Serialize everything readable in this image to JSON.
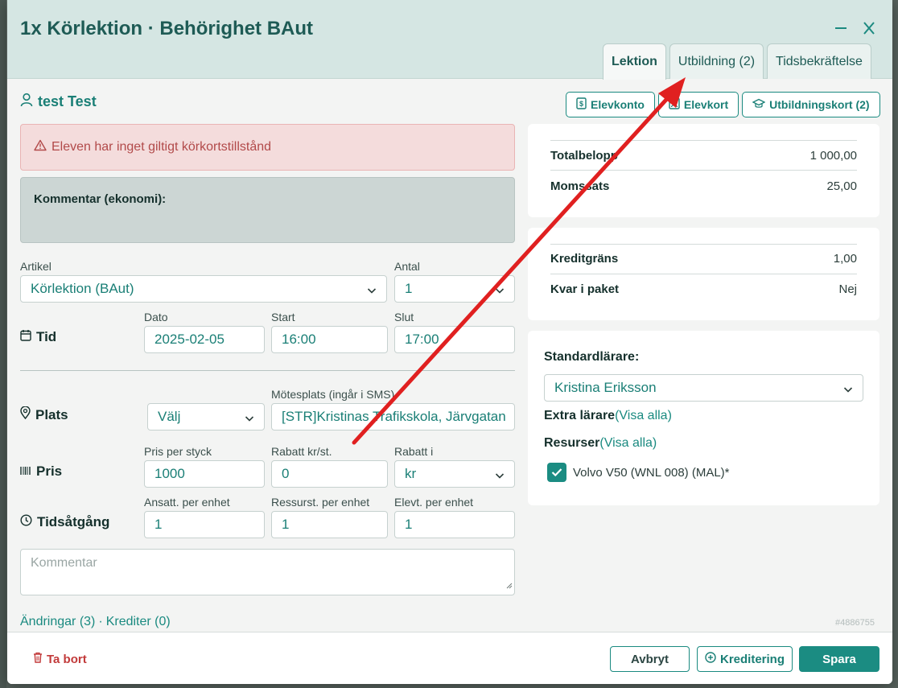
{
  "modal": {
    "title": "1x Körlektion · Behörighet BAut"
  },
  "tabs": [
    {
      "label": "Lektion"
    },
    {
      "label": "Utbildning (2)"
    },
    {
      "label": "Tidsbekräftelse"
    }
  ],
  "student": {
    "name": "test Test"
  },
  "head_buttons": {
    "account": "Elevkonto",
    "card": "Elevkort",
    "education_card": "Utbildningskort (2)"
  },
  "alert": {
    "text": "Eleven har inget giltigt körkortstillstånd"
  },
  "comment_economy": {
    "label": "Kommentar (ekonomi):"
  },
  "form": {
    "article": {
      "label": "Artikel",
      "value": "Körlektion (BAut)"
    },
    "quantity": {
      "label": "Antal",
      "value": "1"
    },
    "time": {
      "heading": "Tid",
      "date_label": "Dato",
      "date_value": "2025-02-05",
      "start_label": "Start",
      "start_value": "16:00",
      "end_label": "Slut",
      "end_value": "17:00"
    },
    "place": {
      "heading": "Plats",
      "select_value": "Välj",
      "meeting_label": "Mötesplats (ingår i SMS)",
      "meeting_value": "[STR]Kristinas Trafikskola, Järvgatan"
    },
    "price": {
      "heading": "Pris",
      "unit_label": "Pris per styck",
      "unit_value": "1000",
      "discount_label": "Rabatt kr/st.",
      "discount_value": "0",
      "discount_in_label": "Rabatt i",
      "discount_in_value": "kr"
    },
    "time_usage": {
      "heading": "Tidsåtgång",
      "employee_label": "Ansatt. per enhet",
      "employee_value": "1",
      "resource_label": "Ressurst. per enhet",
      "resource_value": "1",
      "student_label": "Elevt. per enhet",
      "student_value": "1"
    },
    "comment": {
      "placeholder": "Kommentar"
    },
    "changes": {
      "changes_link": "Ändringar (3)",
      "separator": "·",
      "credits_link": "Krediter (0)"
    },
    "record_id": "#4886755"
  },
  "summary": {
    "total_label": "Totalbelopp",
    "total_value": "1 000,00",
    "vat_label": "Momssats",
    "vat_value": "25,00"
  },
  "credit": {
    "limit_label": "Kreditgräns",
    "limit_value": "1,00",
    "package_label": "Kvar i paket",
    "package_value": "Nej"
  },
  "teacher": {
    "label": "Standardlärare:",
    "value": "Kristina Eriksson",
    "extra_label": "Extra lärare",
    "extra_link": "(Visa alla)",
    "resources_label": "Resurser",
    "resources_link": "(Visa alla)",
    "resource_item": "Volvo V50 (WNL 008) (MAL)*",
    "resource_checked": true
  },
  "footer": {
    "delete": "Ta bort",
    "cancel": "Avbryt",
    "credit": "Kreditering",
    "save": "Spara"
  },
  "colors": {
    "accent": "#1b8c82",
    "header_bg": "#d5e6e3",
    "alert_bg": "#f4dcdc",
    "danger": "#c23a3a",
    "annotation_arrow": "#e02020"
  }
}
